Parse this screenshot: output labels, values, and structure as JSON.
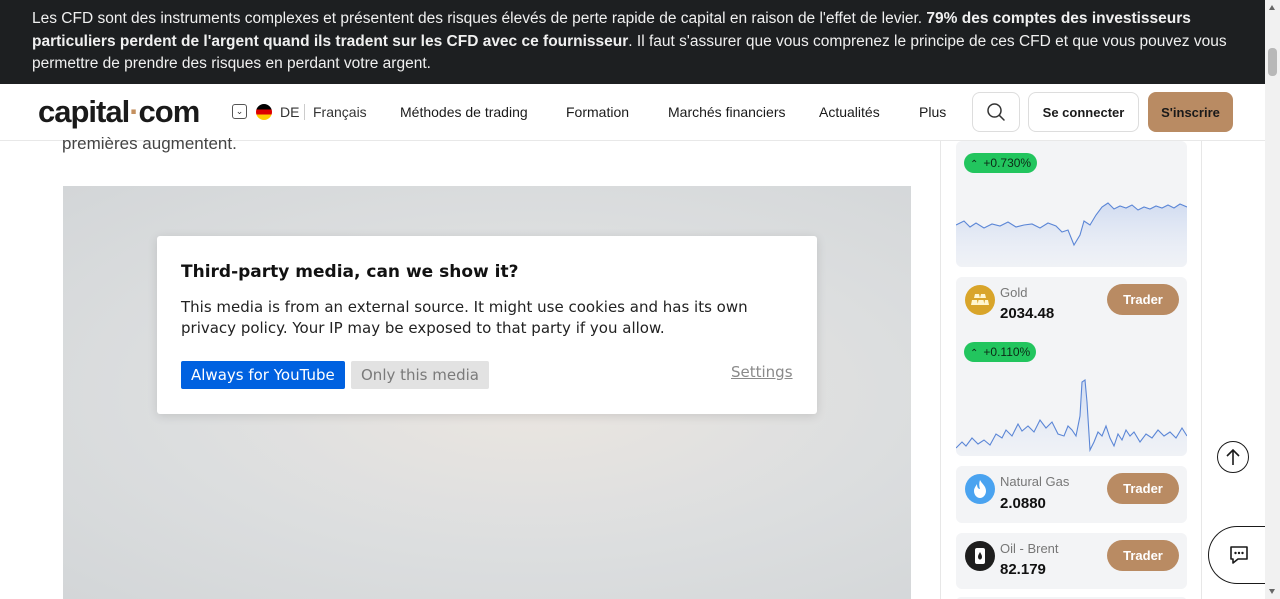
{
  "risk_banner": {
    "text_start": "Les CFD sont des instruments complexes et présentent des risques élevés de perte rapide de capital en raison de l'effet de levier. ",
    "text_bold": "79% des comptes des investisseurs particuliers perdent de l'argent quand ils tradent sur les CFD avec ce fournisseur",
    "text_end": ". Il faut s'assurer que vous comprenez le principe de ces CFD et que vous pouvez vous permettre de prendre des risques en perdant votre argent."
  },
  "header": {
    "logo_part1": "capital",
    "logo_dot": "·",
    "logo_part2": "com",
    "lang_code": "DE",
    "lang_name": "Français",
    "nav": [
      "Méthodes de trading",
      "Formation",
      "Marchés financiers",
      "Actualités",
      "Plus"
    ],
    "login_label": "Se connecter",
    "signup_label": "S'inscrire"
  },
  "article": {
    "tail_text": "premières augmentent."
  },
  "consent": {
    "title": "Third-party media, can we show it?",
    "text": "This media is from an external source. It might use cookies and has its own privacy policy. Your IP may be exposed to that party if you allow.",
    "always_label": "Always for YouTube",
    "only_label": "Only this media",
    "settings_label": "Settings"
  },
  "markets": {
    "trade_label": "Trader",
    "top_card": {
      "change": "+0.730%"
    },
    "items": [
      {
        "name": "Gold",
        "price": "2034.48",
        "change": "+0.110%"
      },
      {
        "name": "Natural Gas",
        "price": "2.0880"
      },
      {
        "name": "Oil - Brent",
        "price": "82.179"
      }
    ]
  },
  "colors": {
    "accent": "#b98b63",
    "positive": "#22c55e",
    "consent_primary": "#0061e0",
    "banner_bg": "#1d1f21"
  },
  "icons": {
    "search": "search-icon",
    "chevron": "chevron-up-icon",
    "chat": "chat-icon",
    "scroll_top": "arrow-up-icon"
  }
}
